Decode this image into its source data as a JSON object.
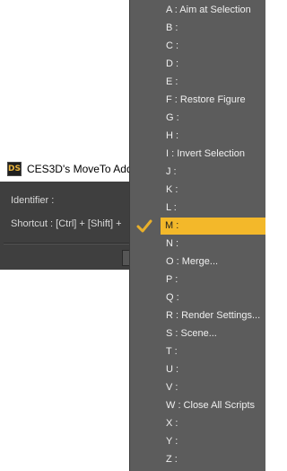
{
  "dialog": {
    "logo_text": "DS",
    "title": "CES3D's MoveTo Add-",
    "identifier_label": "Identifier :",
    "shortcut_label": "Shortcut : [Ctrl] + [Shift] +"
  },
  "menu": {
    "items": [
      {
        "label": "A : Aim at Selection"
      },
      {
        "label": "B :"
      },
      {
        "label": "C :"
      },
      {
        "label": "D :"
      },
      {
        "label": "E :"
      },
      {
        "label": "F : Restore Figure"
      },
      {
        "label": "G :"
      },
      {
        "label": "H :"
      },
      {
        "label": "I : Invert Selection"
      },
      {
        "label": "J :"
      },
      {
        "label": "K :"
      },
      {
        "label": "L :"
      },
      {
        "label": "M :"
      },
      {
        "label": "N :"
      },
      {
        "label": "O : Merge..."
      },
      {
        "label": "P :"
      },
      {
        "label": "Q :"
      },
      {
        "label": "R : Render Settings..."
      },
      {
        "label": "S : Scene..."
      },
      {
        "label": "T :"
      },
      {
        "label": "U :"
      },
      {
        "label": "V :"
      },
      {
        "label": "W : Close All Scripts"
      },
      {
        "label": "X :"
      },
      {
        "label": "Y :"
      },
      {
        "label": "Z :"
      }
    ],
    "selected_label": "M :",
    "check_icon": "checkmark-icon",
    "accent_color": "#f3b82a"
  }
}
